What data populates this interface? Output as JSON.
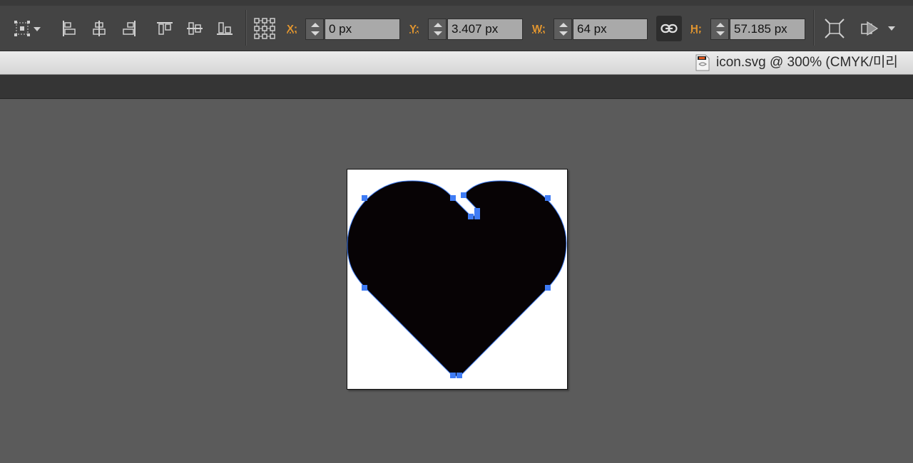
{
  "control_bar": {
    "x_label": "X:",
    "x_value": "0 px",
    "y_label": "Y:",
    "y_value": "3.407 px",
    "w_label": "W:",
    "w_value": "64 px",
    "h_label": "H:",
    "h_value": "57.185 px"
  },
  "document": {
    "title": "icon.svg @ 300% (CMYK/미리",
    "icon": "svg-file-icon"
  },
  "icons": {
    "transform_reference": "transform-reference-icon",
    "align_left": "align-left-icon",
    "align_center_h": "align-center-horizontal-icon",
    "align_right": "align-right-icon",
    "align_top": "align-top-icon",
    "align_center_v": "align-center-vertical-icon",
    "align_bottom": "align-bottom-icon",
    "reference_point": "reference-point-grid-icon",
    "constrain": "link-icon",
    "transform_each": "transform-each-icon",
    "isolate": "isolate-icon"
  },
  "colors": {
    "accent_label": "#e3962f",
    "selection": "#3f7cf5",
    "shape_fill": "#070305"
  }
}
